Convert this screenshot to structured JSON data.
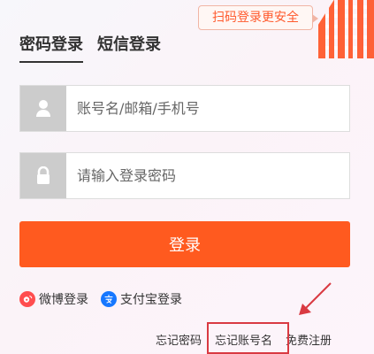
{
  "header": {
    "qr_tip": "扫码登录更安全",
    "qr_icon": "qr-code-icon"
  },
  "tabs": [
    {
      "label": "密码登录",
      "active": true
    },
    {
      "label": "短信登录",
      "active": false
    }
  ],
  "form": {
    "username_placeholder": "账号名/邮箱/手机号",
    "username_value": "",
    "password_placeholder": "请输入登录密码",
    "password_value": "",
    "user_icon": "user-icon",
    "lock_icon": "lock-icon"
  },
  "login_button": {
    "label": "登录",
    "color": "#ff5a1f"
  },
  "third_party_login": [
    {
      "label": "微博登录",
      "icon": "weibo-icon",
      "color": "#ff4d4f"
    },
    {
      "label": "支付宝登录",
      "icon": "alipay-icon",
      "color": "#1677ff"
    }
  ],
  "links": {
    "forgot_password": "忘记密码",
    "forgot_account": "忘记账号名",
    "register": "免费注册"
  },
  "highlight": {
    "color": "#d93a42"
  }
}
